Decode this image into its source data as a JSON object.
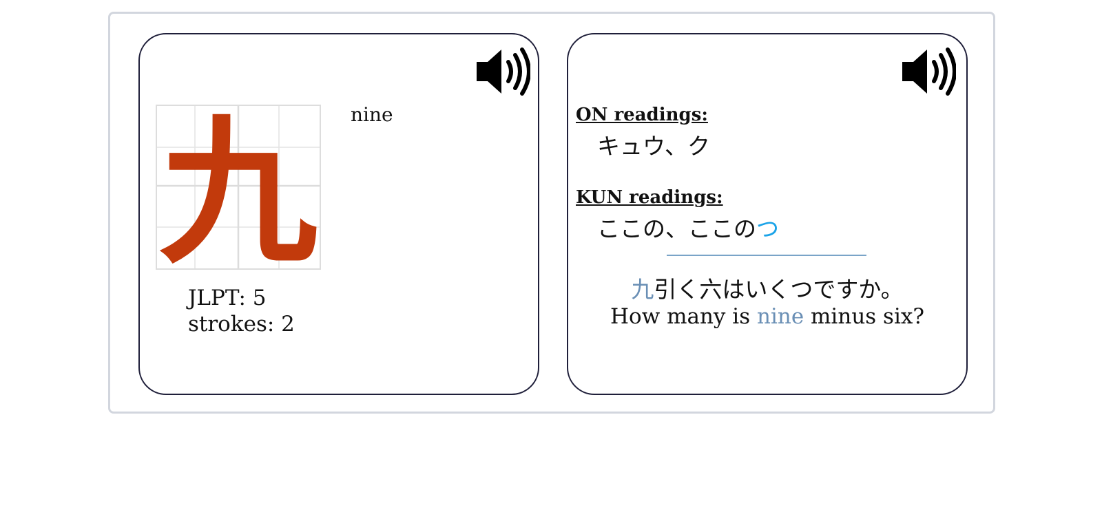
{
  "kanji_card": {
    "kanji": "九",
    "kanji_color": "#c23a0c",
    "meaning": "nine",
    "jlpt": "JLPT: 5",
    "strokes": "strokes: 2",
    "audio_icon": "speaker-icon"
  },
  "readings_card": {
    "on_label": "ON readings:",
    "on_values": "キュウ、ク",
    "kun_label": "KUN readings:",
    "kun_values_main": "ここの、ここの",
    "kun_values_okurigana": "つ",
    "okurigana_color": "#1aa3e8",
    "audio_icon": "speaker-icon",
    "example_jp_highlight": "九",
    "example_jp_rest": "引く六はいくつですか。",
    "example_en_before": "How many is ",
    "example_en_highlight": "nine",
    "example_en_after": " minus six?",
    "highlight_color": "#6a8fb5"
  }
}
